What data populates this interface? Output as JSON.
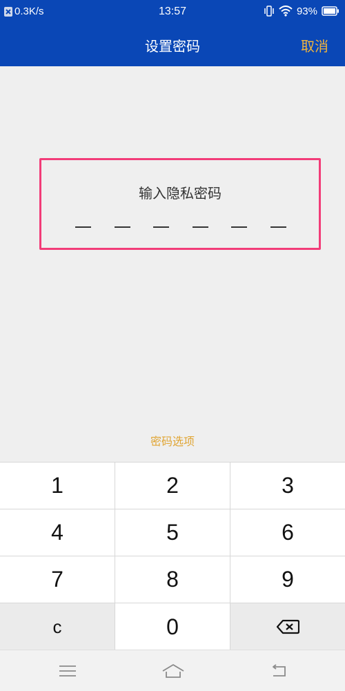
{
  "status_bar": {
    "net_speed": "0.3K/s",
    "time": "13:57",
    "battery": "93%",
    "icons": [
      "vibrate-icon",
      "wifi-icon",
      "battery-icon"
    ]
  },
  "header": {
    "title": "设置密码",
    "cancel_label": "取消"
  },
  "password_box": {
    "prompt": "输入隐私密码",
    "digits_entered": 0,
    "slots": 6
  },
  "options_link": "密码选项",
  "keypad": {
    "rows": [
      [
        "1",
        "2",
        "3"
      ],
      [
        "4",
        "5",
        "6"
      ],
      [
        "7",
        "8",
        "9"
      ],
      [
        "c",
        "0",
        "⌫"
      ]
    ]
  },
  "nav_bar": {
    "icons": [
      "menu-icon",
      "home-icon",
      "back-icon"
    ]
  },
  "colors": {
    "header_bg": "#0a47b6",
    "accent": "#f0b43c",
    "box_border": "#f23c78",
    "background": "#efefef"
  }
}
